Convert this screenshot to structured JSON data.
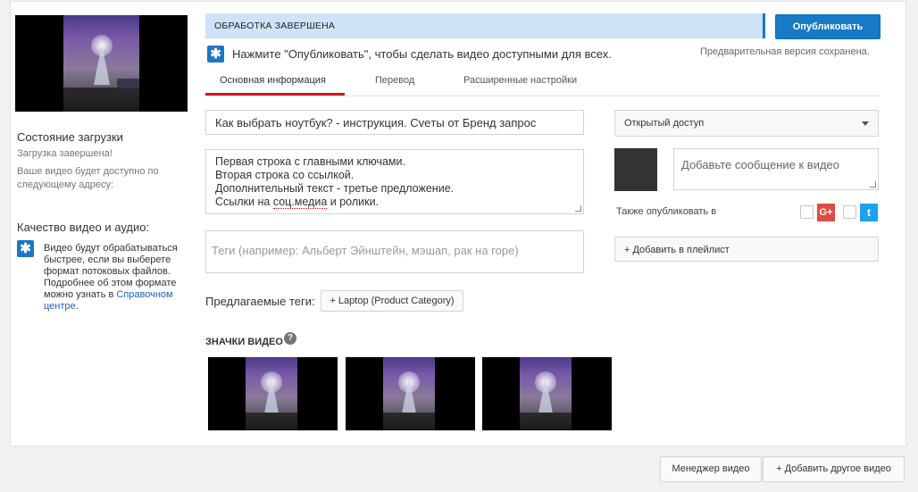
{
  "left": {
    "upload_status_title": "Состояние загрузки",
    "upload_complete": "Загрузка завершена!",
    "available_at": "Ваше видео будет доступно по следующему адресу:",
    "quality_title": "Качество видео и аудио:",
    "quality_text": "Видео будут обрабатываться быстрее, если вы выберете формат потоковых файлов. Подробнее об этом формате можно узнать в",
    "help_link": "Справочном центре",
    "help_link_suffix": "."
  },
  "status": {
    "banner": "ОБРАБОТКА ЗАВЕРШЕНА",
    "publish_label": "Опубликовать",
    "hint": "Нажмите \"Опубликовать\", чтобы сделать видео доступными для всех.",
    "saved": "Предварительная версия сохранена."
  },
  "tabs": [
    {
      "label": "Основная информация",
      "active": true
    },
    {
      "label": "Перевод",
      "active": false
    },
    {
      "label": "Расширенные настройки",
      "active": false
    }
  ],
  "form": {
    "title_value": "Как выбрать ноутбук? - инструкция. Сveты от Бренд запрос",
    "description_lines": [
      "Первая строка с главными ключами.",
      "Вторая строка со ссылкой.",
      "Дополнительный текст - третье предложение.",
      "Ссылки на соц.медиа и ролики."
    ],
    "tags_placeholder": "Теги (например: Альберт Эйнштейн, мэшап, рак на горе)",
    "suggested_label": "Предлагаемые теги:",
    "suggested_tag": "+ Laptop (Product Category)",
    "thumbnails_label": "ЗНАЧКИ ВИДЕО",
    "help_icon": "?"
  },
  "side": {
    "privacy": "Открытый доступ",
    "message_placeholder": "Добавьте сообщение к видео",
    "also_publish": "Также опубликовать в",
    "gplus_icon": "G+",
    "twitter_icon": "t",
    "add_playlist": "+ Добавить в плейлист"
  },
  "footer": {
    "manager": "Менеджер видео",
    "add_another": "+ Добавить другое видео"
  },
  "colors": {
    "accent": "#167ac6",
    "banner_bg": "#cfe3f7",
    "active_tab": "#cc181e"
  }
}
